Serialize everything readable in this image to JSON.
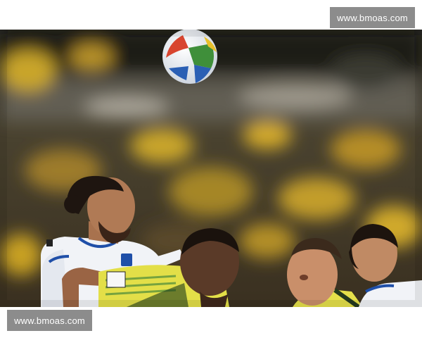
{
  "watermarks": {
    "top": "www.bmoas.com",
    "bottom": "www.bmoas.com"
  },
  "photo": {
    "alt": "",
    "colors": {
      "crowd_dark": "#2a2416",
      "crowd_yellow": "#c8a021",
      "jersey_white": "#f1f3f7",
      "jersey_yellow": "#e5e04a",
      "skin": "#b07a55",
      "skin_dark": "#5a3a28"
    }
  }
}
